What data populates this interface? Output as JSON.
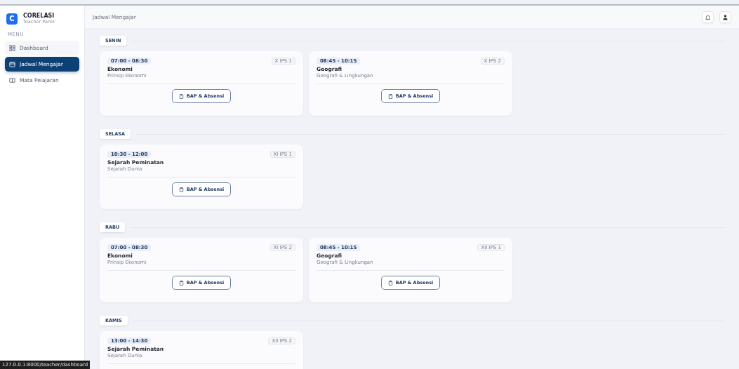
{
  "sidebar": {
    "brand": {
      "logo_letter": "C",
      "title": "CORELASI",
      "subtitle": "Teacher Panel"
    },
    "section_label": "MENU",
    "items": [
      {
        "kind": "dashboard",
        "label": "Dashboard",
        "selected": false
      },
      {
        "kind": "calendar",
        "label": "Jadwal Mengajar",
        "selected": true
      },
      {
        "kind": "book",
        "label": "Mata Pelajaran",
        "selected": false
      }
    ]
  },
  "header": {
    "title": "Jadwal Mengajar"
  },
  "days": [
    {
      "day": "SENIN",
      "classes": [
        {
          "time": "07:00 - 08:30",
          "class": "X IPS 1",
          "subject": "Ekonomi",
          "topic": "Prinsip Ekonomi",
          "action": "BAP & Absensi"
        },
        {
          "time": "08:45 - 10:15",
          "class": "X IPS 2",
          "subject": "Geografi",
          "topic": "Geografi & Lingkungan",
          "action": "BAP & Absensi"
        }
      ]
    },
    {
      "day": "SELASA",
      "classes": [
        {
          "time": "10:30 - 12:00",
          "class": "XI IPS 1",
          "subject": "Sejarah Peminatan",
          "topic": "Sejarah Dunia",
          "action": "BAP & Absensi"
        }
      ]
    },
    {
      "day": "RABU",
      "classes": [
        {
          "time": "07:00 - 08:30",
          "class": "XI IPS 2",
          "subject": "Ekonomi",
          "topic": "Prinsip Ekonomi",
          "action": "BAP & Absensi"
        },
        {
          "time": "08:45 - 10:15",
          "class": "XII IPS 1",
          "subject": "Geografi",
          "topic": "Geografi & Lingkungan",
          "action": "BAP & Absensi"
        }
      ]
    },
    {
      "day": "KAMIS",
      "classes": [
        {
          "time": "13:00 - 14:30",
          "class": "XII IPS 2",
          "subject": "Sejarah Peminatan",
          "topic": "Sejarah Dunia"
        }
      ]
    }
  ],
  "status_bar": {
    "url": "127.0.0.1:8000/teacher/dashboard"
  }
}
